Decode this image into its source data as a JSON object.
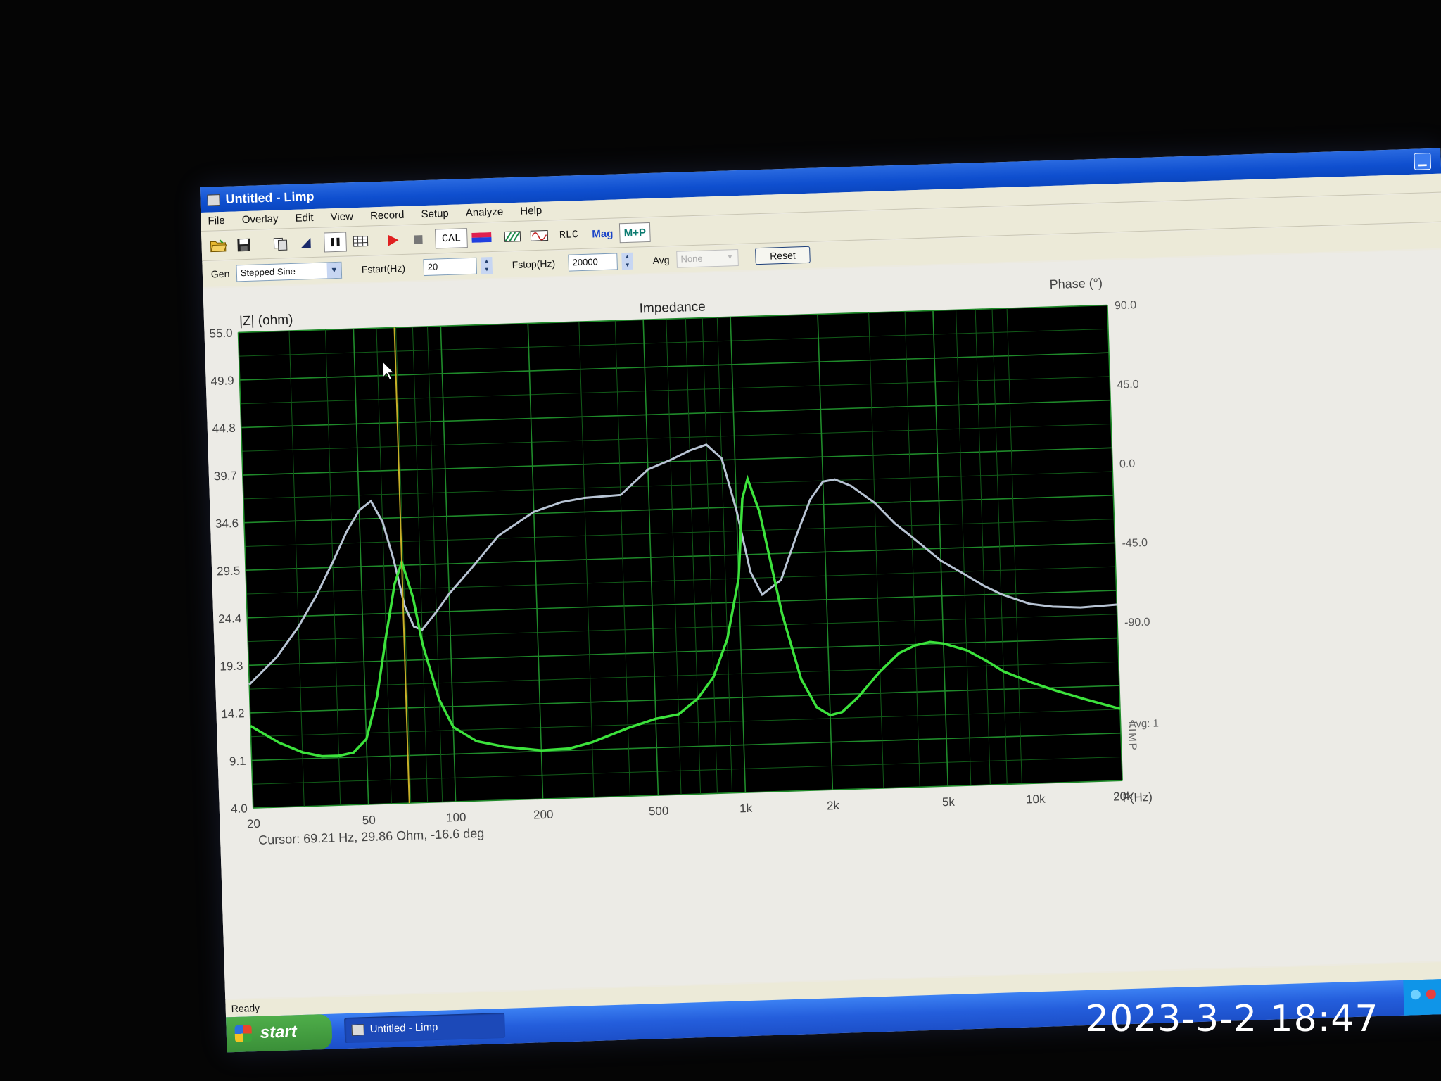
{
  "window": {
    "title": "Untitled - Limp",
    "menu": [
      "File",
      "Overlay",
      "Edit",
      "View",
      "Record",
      "Setup",
      "Analyze",
      "Help"
    ]
  },
  "toolbar": {
    "cal_label": "CAL",
    "rlc_label": "RLC",
    "mag_label": "Mag",
    "mp_label": "M+P"
  },
  "generator": {
    "gen_label": "Gen",
    "gen_value": "Stepped Sine",
    "fstart_label": "Fstart(Hz)",
    "fstart_value": "20",
    "fstop_label": "Fstop(Hz)",
    "fstop_value": "20000",
    "avg_label": "Avg",
    "avg_value": "None",
    "reset_label": "Reset"
  },
  "chart_data": {
    "type": "line",
    "title": "Impedance",
    "ylabel": "|Z| (ohm)",
    "y2label": "Phase (°)",
    "xlabel": "F(Hz)",
    "x_scale": "log",
    "xlim": [
      20,
      20000
    ],
    "ylim": [
      4.0,
      55.0
    ],
    "y2lim": [
      -180,
      90
    ],
    "y_ticks": [
      "55.0",
      "49.9",
      "44.8",
      "39.7",
      "34.6",
      "29.5",
      "24.4",
      "19.3",
      "14.2",
      "9.1",
      "4.0"
    ],
    "y2_ticks": [
      "90.0",
      "45.0",
      "0.0",
      "-45.0",
      "-90.0"
    ],
    "x_ticks": [
      {
        "v": 20,
        "label": "20"
      },
      {
        "v": 50,
        "label": "50"
      },
      {
        "v": 100,
        "label": "100"
      },
      {
        "v": 200,
        "label": "200"
      },
      {
        "v": 500,
        "label": "500"
      },
      {
        "v": 1000,
        "label": "1k"
      },
      {
        "v": 2000,
        "label": "2k"
      },
      {
        "v": 5000,
        "label": "5k"
      },
      {
        "v": 10000,
        "label": "10k"
      },
      {
        "v": 20000,
        "label": "20k"
      }
    ],
    "avg_note": "Avg: 1",
    "side_label": "LIMP",
    "grid": true,
    "cursor": {
      "x": 69.21,
      "text": "Cursor: 69.21 Hz, 29.86 Ohm, -16.6 deg"
    },
    "series": [
      {
        "role": "impedance",
        "color": "#3ce23c",
        "x": [
          20,
          25,
          30,
          35,
          40,
          45,
          50,
          55,
          60,
          65,
          69.2,
          75,
          80,
          90,
          100,
          120,
          150,
          200,
          250,
          300,
          400,
          500,
          600,
          700,
          800,
          900,
          1000,
          1050,
          1100,
          1200,
          1400,
          1600,
          1800,
          2000,
          2200,
          2500,
          3000,
          3500,
          4000,
          4500,
          5000,
          6000,
          7000,
          8000,
          10000,
          12000,
          15000,
          20000
        ],
        "y": [
          12.8,
          10.9,
          9.8,
          9.3,
          9.3,
          9.6,
          11.0,
          15.5,
          22.0,
          27.5,
          29.86,
          26.0,
          21.0,
          15.0,
          12.0,
          10.4,
          9.7,
          9.2,
          9.3,
          9.9,
          11.3,
          12.2,
          12.6,
          14.2,
          16.5,
          20.5,
          27.0,
          35.5,
          37.6,
          34.0,
          23.0,
          16.0,
          12.9,
          12.0,
          12.3,
          13.8,
          16.5,
          18.4,
          19.2,
          19.5,
          19.3,
          18.5,
          17.3,
          16.1,
          14.8,
          13.9,
          12.9,
          11.7
        ]
      },
      {
        "role": "phase",
        "color": "#b8c4d4",
        "x": [
          20,
          25,
          30,
          35,
          40,
          45,
          50,
          55,
          60,
          65,
          70,
          75,
          80,
          90,
          100,
          120,
          150,
          200,
          250,
          300,
          400,
          500,
          600,
          700,
          800,
          900,
          1000,
          1100,
          1200,
          1400,
          1600,
          1800,
          2000,
          2200,
          2500,
          3000,
          3500,
          4000,
          5000,
          6000,
          7000,
          8000,
          10000,
          12000,
          15000,
          20000
        ],
        "y": [
          -110,
          -95,
          -78,
          -60,
          -42,
          -25,
          -13,
          -8,
          -20,
          -42,
          -68,
          -80,
          -82,
          -72,
          -62,
          -48,
          -30,
          -17,
          -12,
          -10,
          -9,
          5,
          10,
          15,
          18,
          10,
          -20,
          -55,
          -68,
          -60,
          -35,
          -15,
          -5,
          -4,
          -8,
          -18,
          -30,
          -38,
          -52,
          -60,
          -67,
          -72,
          -78,
          -80,
          -81,
          -80
        ]
      }
    ]
  },
  "status": {
    "text": "Ready"
  },
  "taskbar": {
    "start_label": "start",
    "task_label": "Untitled - Limp"
  },
  "photo": {
    "timestamp": "2023-3-2 18:47"
  }
}
